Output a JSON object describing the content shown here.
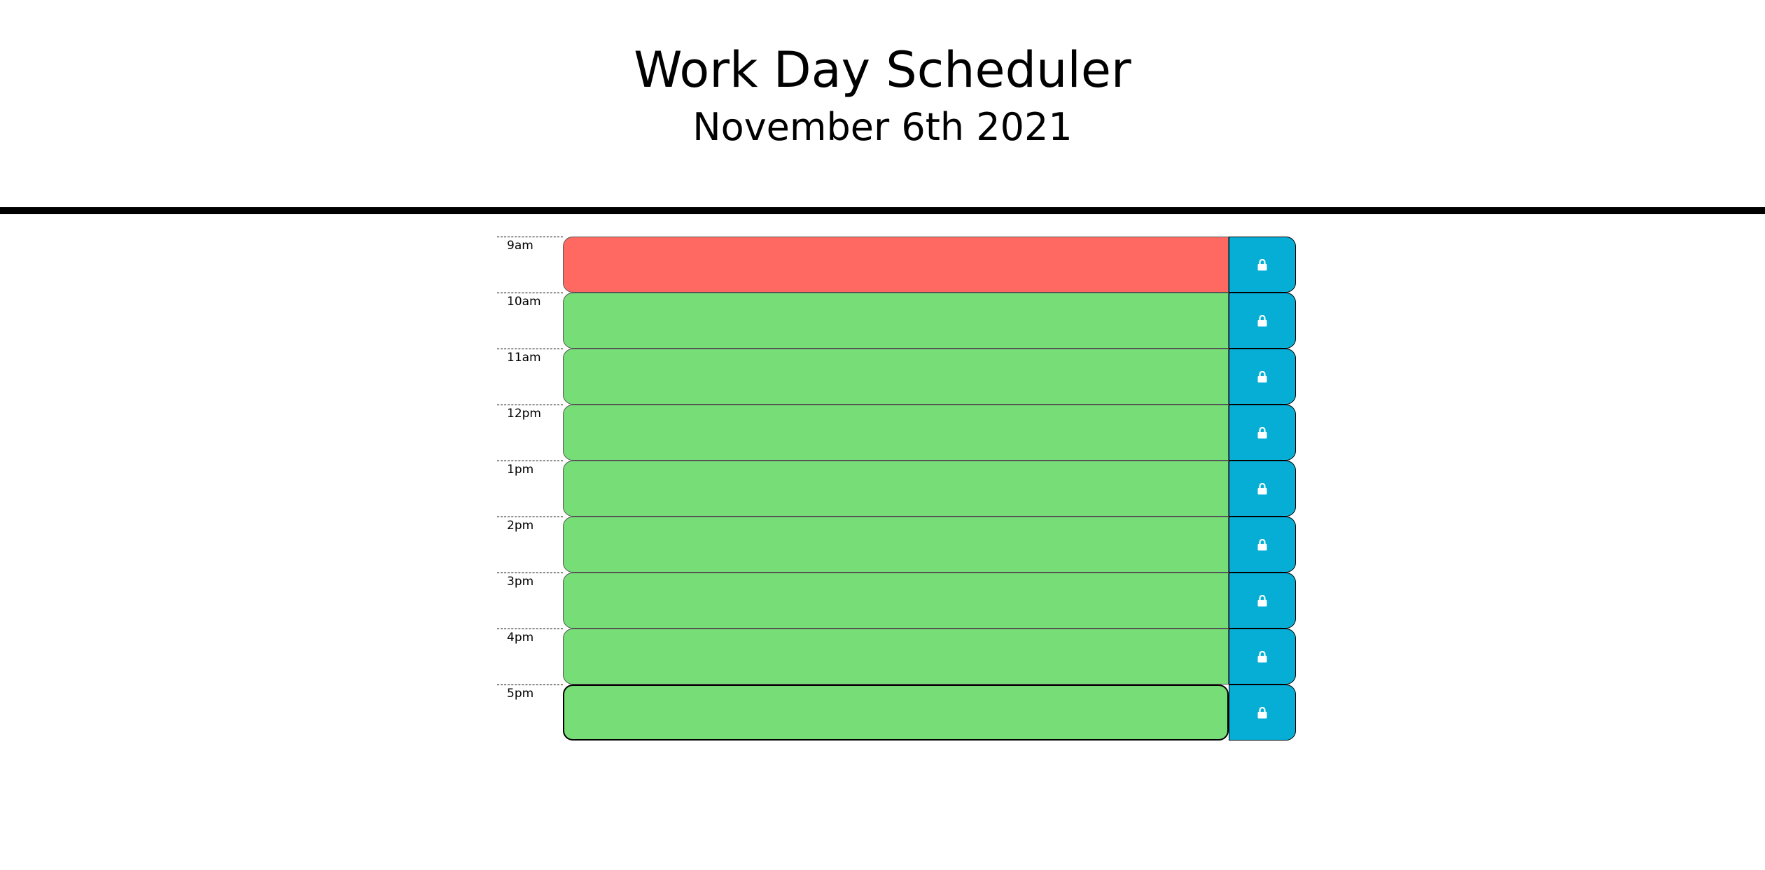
{
  "header": {
    "title": "Work Day Scheduler",
    "date": "November 6th 2021"
  },
  "colors": {
    "past": "#ff6961",
    "future": "#77dd77",
    "save_button": "#06aed5"
  },
  "icons": {
    "save": "lock-icon"
  },
  "time_blocks": [
    {
      "hour": "9am",
      "text": "",
      "state": "present"
    },
    {
      "hour": "10am",
      "text": "",
      "state": "future"
    },
    {
      "hour": "11am",
      "text": "",
      "state": "future"
    },
    {
      "hour": "12pm",
      "text": "",
      "state": "future"
    },
    {
      "hour": "1pm",
      "text": "",
      "state": "future"
    },
    {
      "hour": "2pm",
      "text": "",
      "state": "future"
    },
    {
      "hour": "3pm",
      "text": "",
      "state": "future"
    },
    {
      "hour": "4pm",
      "text": "",
      "state": "future"
    },
    {
      "hour": "5pm",
      "text": "",
      "state": "future"
    }
  ]
}
